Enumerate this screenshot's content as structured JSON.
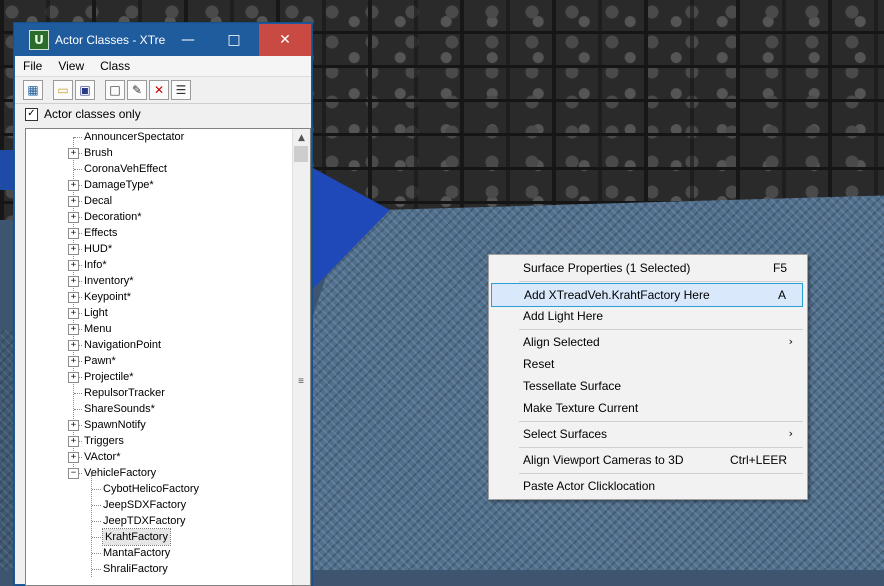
{
  "window": {
    "title": "Actor Classes - XTre",
    "menu": [
      "File",
      "View",
      "Class"
    ],
    "filter_label": "Actor classes only",
    "filter_checked": "✓"
  },
  "tree": [
    {
      "label": "AnnouncerSpectator",
      "expander": ""
    },
    {
      "label": "Brush",
      "expander": "+"
    },
    {
      "label": "CoronaVehEffect",
      "expander": ""
    },
    {
      "label": "DamageType*",
      "expander": "+"
    },
    {
      "label": "Decal",
      "expander": "+"
    },
    {
      "label": "Decoration*",
      "expander": "+"
    },
    {
      "label": "Effects",
      "expander": "+"
    },
    {
      "label": "HUD*",
      "expander": "+"
    },
    {
      "label": "Info*",
      "expander": "+"
    },
    {
      "label": "Inventory*",
      "expander": "+"
    },
    {
      "label": "Keypoint*",
      "expander": "+"
    },
    {
      "label": "Light",
      "expander": "+"
    },
    {
      "label": "Menu",
      "expander": "+"
    },
    {
      "label": "NavigationPoint",
      "expander": "+"
    },
    {
      "label": "Pawn*",
      "expander": "+"
    },
    {
      "label": "Projectile*",
      "expander": "+"
    },
    {
      "label": "RepulsorTracker",
      "expander": ""
    },
    {
      "label": "ShareSounds*",
      "expander": ""
    },
    {
      "label": "SpawnNotify",
      "expander": "+"
    },
    {
      "label": "Triggers",
      "expander": "+"
    },
    {
      "label": "VActor*",
      "expander": "+"
    },
    {
      "label": "VehicleFactory",
      "expander": "−"
    }
  ],
  "subtree": [
    {
      "label": "CybotHelicoFactory"
    },
    {
      "label": "JeepSDXFactory"
    },
    {
      "label": "JeepTDXFactory"
    },
    {
      "label": "KrahtFactory"
    },
    {
      "label": "MantaFactory"
    },
    {
      "label": "ShraliFactory"
    }
  ],
  "selected_item": "KrahtFactory",
  "context_menu": {
    "items": [
      {
        "label": "Surface Properties (1 Selected)",
        "shortcut": "F5"
      },
      {
        "label": "Add XTreadVeh.KrahtFactory Here",
        "shortcut": "A"
      },
      {
        "label": "Add Light Here",
        "shortcut": ""
      },
      {
        "label": "Align Selected",
        "shortcut": "›"
      },
      {
        "label": "Reset",
        "shortcut": ""
      },
      {
        "label": "Tessellate Surface",
        "shortcut": ""
      },
      {
        "label": "Make Texture Current",
        "shortcut": ""
      },
      {
        "label": "Select Surfaces",
        "shortcut": "›"
      },
      {
        "label": "Align Viewport Cameras to 3D",
        "shortcut": "Ctrl+LEER"
      },
      {
        "label": "Paste Actor Clicklocation",
        "shortcut": ""
      }
    ],
    "highlighted": "Add XTreadVeh.KrahtFactory Here"
  },
  "icons": {
    "app": "unreal-editor-icon",
    "toolbar": [
      "class-browser-icon",
      "open-folder-icon",
      "save-icon",
      "new-document-icon",
      "edit-pencil-icon",
      "delete-x-icon",
      "properties-icon"
    ]
  }
}
